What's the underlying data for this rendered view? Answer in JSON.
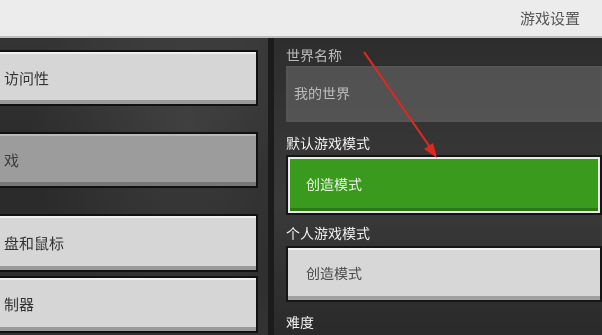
{
  "header": {
    "title": "游戏设置"
  },
  "sidebar": {
    "items": [
      {
        "label": "访问性"
      },
      {
        "label": "戏"
      },
      {
        "label": "盘和鼠标"
      },
      {
        "label": "制器"
      }
    ]
  },
  "settings": {
    "world_name": {
      "label": "世界名称",
      "value": "我的世界"
    },
    "default_mode": {
      "label": "默认游戏模式",
      "value": "创造模式"
    },
    "personal_mode": {
      "label": "个人游戏模式",
      "value": "创造模式"
    },
    "difficulty": {
      "label": "难度"
    }
  },
  "colors": {
    "accent_green": "#3a9a1e",
    "annotation_red": "#e0281e"
  },
  "icons": [
    "annotation-arrow-icon"
  ]
}
